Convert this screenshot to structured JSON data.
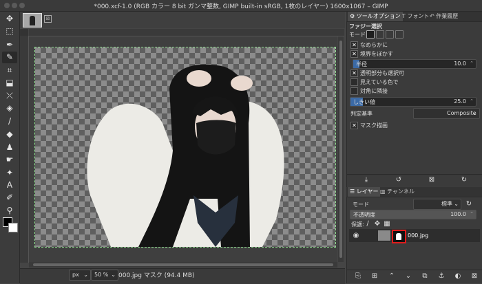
{
  "window": {
    "title": "*000.xcf-1.0 (RGB カラー 8 bit ガンマ整数, GIMP built-in sRGB, 1枚のレイヤー) 1600x1067 – GIMP"
  },
  "image_tab": {
    "close_glyph": "⊠"
  },
  "toolbox": {
    "tools": [
      {
        "name": "move-tool-icon",
        "glyph": "✥"
      },
      {
        "name": "rect-select-tool-icon",
        "glyph": "⬚"
      },
      {
        "name": "lasso-tool-icon",
        "glyph": "✒"
      },
      {
        "name": "fuzzy-select-tool-icon",
        "glyph": "✎"
      },
      {
        "name": "crop-tool-icon",
        "glyph": "⌗"
      },
      {
        "name": "transform-tool-icon",
        "glyph": "⬓"
      },
      {
        "name": "warp-tool-icon",
        "glyph": "⤫"
      },
      {
        "name": "bucket-fill-tool-icon",
        "glyph": "◈"
      },
      {
        "name": "paintbrush-tool-icon",
        "glyph": "∕"
      },
      {
        "name": "eraser-tool-icon",
        "glyph": "◆"
      },
      {
        "name": "clone-tool-icon",
        "glyph": "♟"
      },
      {
        "name": "smudge-tool-icon",
        "glyph": "☛"
      },
      {
        "name": "dodge-tool-icon",
        "glyph": "✦"
      },
      {
        "name": "text-tool-icon",
        "glyph": "A"
      },
      {
        "name": "color-picker-tool-icon",
        "glyph": "✐"
      },
      {
        "name": "zoom-tool-icon",
        "glyph": "⚲"
      }
    ]
  },
  "statusbar": {
    "unit": "px",
    "zoom": "50 %",
    "message": "000.jpg マスク (94.4 MB)"
  },
  "tool_options": {
    "tabs": [
      "ツールオプション",
      "フォント",
      "作業履歴"
    ],
    "title": "ファジー選択",
    "mode_label": "モード",
    "antialias": "なめらかに",
    "feather": "境界をぼかす",
    "radius_label": "半径",
    "radius_value": "10.0",
    "radius_fraction": 0.05,
    "select_transparent": "透明部分も選択可",
    "sample_merged": "見えている色で",
    "diagonal": "対角に隣接",
    "threshold_label": "しきい値",
    "threshold_value": "25.0",
    "threshold_fraction": 0.1,
    "select_by_label": "判定基準",
    "select_by_value": "Composite",
    "draw_mask": "マスク描画"
  },
  "layers": {
    "tabs": [
      "レイヤー",
      "チャンネル"
    ],
    "mode_label": "モード",
    "mode_value": "標準",
    "opacity_label": "不透明度",
    "opacity_value": "100.0",
    "opacity_fraction": 1.0,
    "lock_label": "保護:",
    "layer_name": "000.jpg"
  },
  "colors": {
    "selection_outline": "#8fe08f",
    "mask_highlight": "#e21b1b",
    "slider_fill": "#3b6aa6"
  }
}
